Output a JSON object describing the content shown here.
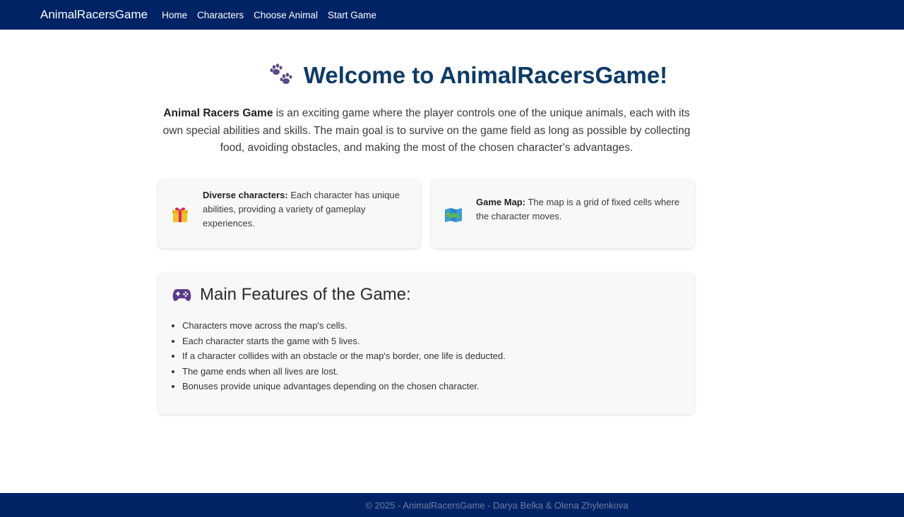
{
  "nav": {
    "brand": "AnimalRacersGame",
    "links": [
      "Home",
      "Characters",
      "Choose Animal",
      "Start Game"
    ]
  },
  "hero": {
    "icon": "paw-prints-icon",
    "title": "Welcome to AnimalRacersGame!"
  },
  "intro": {
    "bold": "Animal Racers Game",
    "text": " is an exciting game where the player controls one of the unique animals, each with its own special abilities and skills. The main goal is to survive on the game field as long as possible by collecting food, avoiding obstacles, and making the most of the chosen character's advantages."
  },
  "cards": [
    {
      "icon": "gift-icon",
      "bold": "Diverse characters:",
      "text": " Each character has unique abilities, providing a variety of gameplay experiences."
    },
    {
      "icon": "map-icon",
      "bold": "Game Map:",
      "text": " The map is a grid of fixed cells where the character moves."
    }
  ],
  "features": {
    "icon": "gamepad-icon",
    "title": "Main Features of the Game:",
    "items": [
      "Characters move across the map's cells.",
      "Each character starts the game with 5 lives.",
      "If a character collides with an obstacle or the map's border, one life is deducted.",
      "The game ends when all lives are lost.",
      "Bonuses provide unique advantages depending on the chosen character."
    ]
  },
  "footer": {
    "text": "© 2025 - AnimalRacersGame - Darya Belka & Olena Zhylenkova"
  },
  "colors": {
    "navbar": "#002366",
    "title": "#0d3b66",
    "card_bg": "#f8f8f8"
  }
}
